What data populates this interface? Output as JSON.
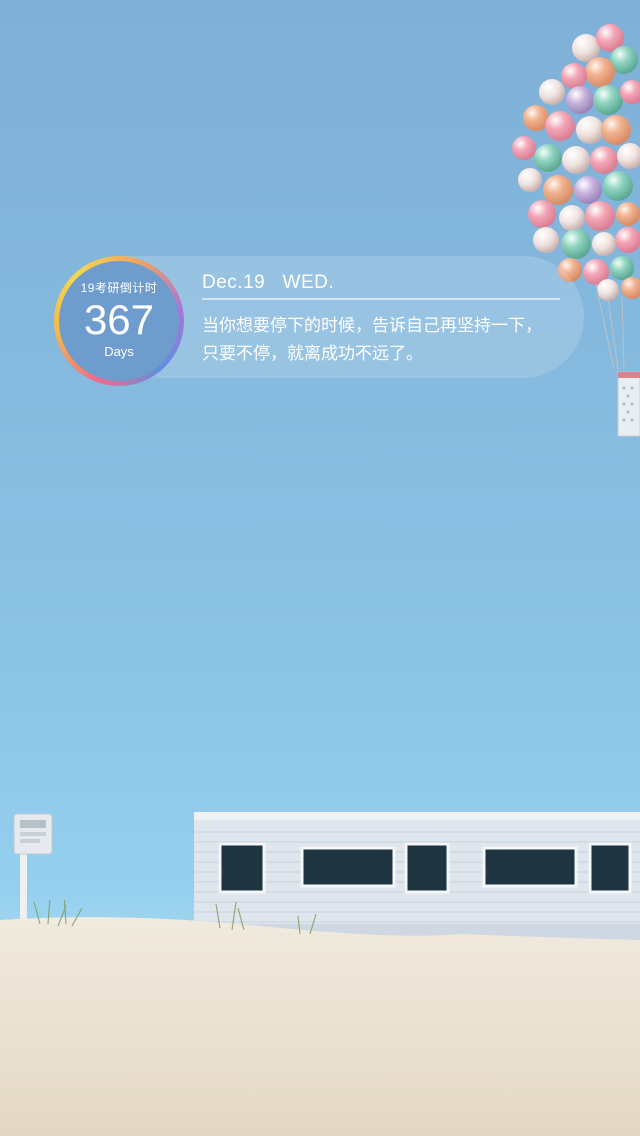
{
  "countdown": {
    "caption": "19考研倒计时",
    "number": "367",
    "unit": "Days"
  },
  "header": {
    "date": "Dec.19",
    "weekday": "WED."
  },
  "quote": {
    "line1": "当你想要停下的时候，告诉自己再坚持一下，",
    "line2": "只要不停，就离成功不远了。"
  },
  "colors": {
    "sky_top": "#7fb0d8",
    "sky_bottom": "#9fd6f0",
    "sand": "#ece3d2",
    "house": "#dfe6ee"
  },
  "icons": {
    "balloons": "balloon-cluster-icon",
    "sign": "beach-sign-icon"
  }
}
